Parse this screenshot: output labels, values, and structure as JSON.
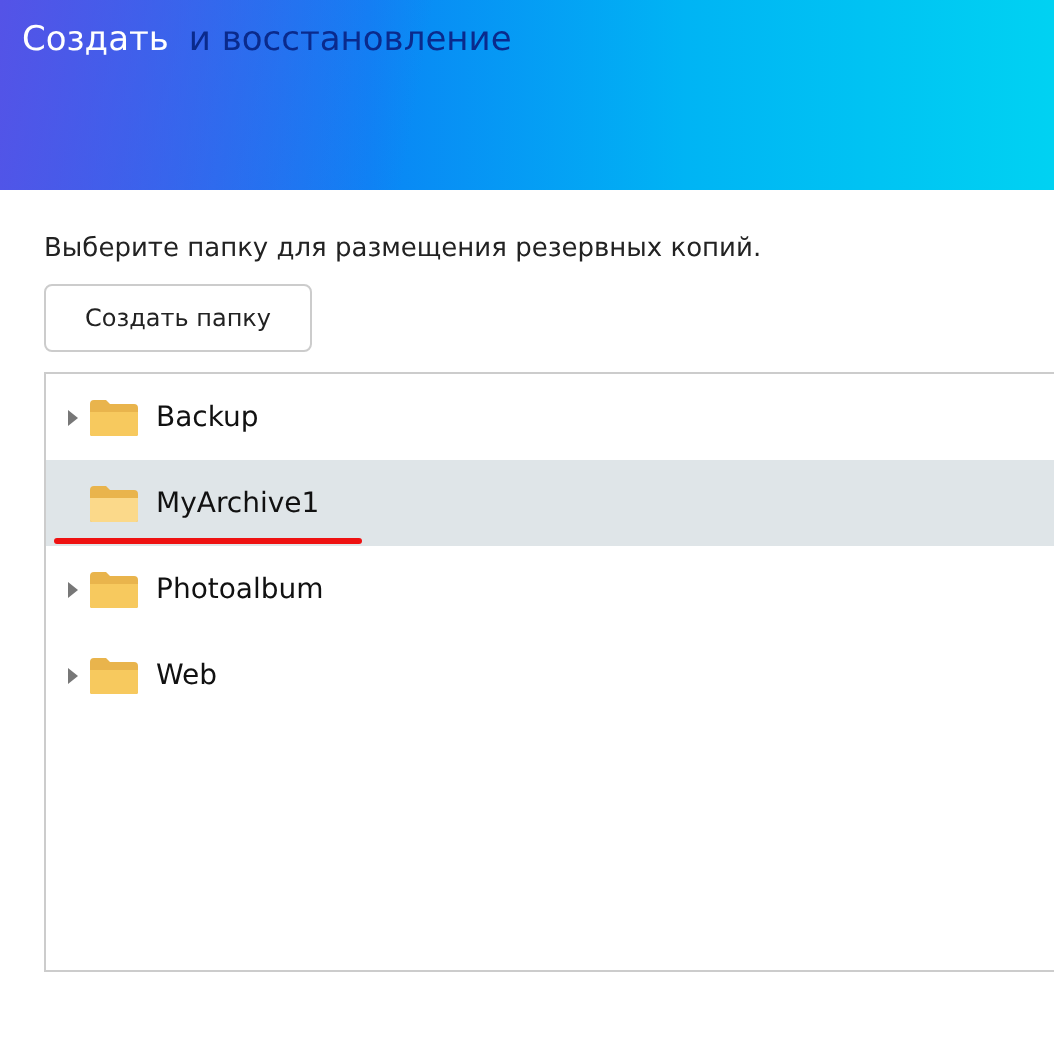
{
  "header": {
    "title": "Создать",
    "background_title": "и восстановление"
  },
  "instruction": "Выберите папку для размещения резервных копий.",
  "create_button": "Создать папку",
  "folders": [
    {
      "name": "Backup",
      "expandable": true,
      "selected": false,
      "marked": false
    },
    {
      "name": "MyArchive1",
      "expandable": false,
      "selected": true,
      "marked": true
    },
    {
      "name": "Photoalbum",
      "expandable": true,
      "selected": false,
      "marked": false
    },
    {
      "name": "Web",
      "expandable": true,
      "selected": false,
      "marked": false
    }
  ]
}
